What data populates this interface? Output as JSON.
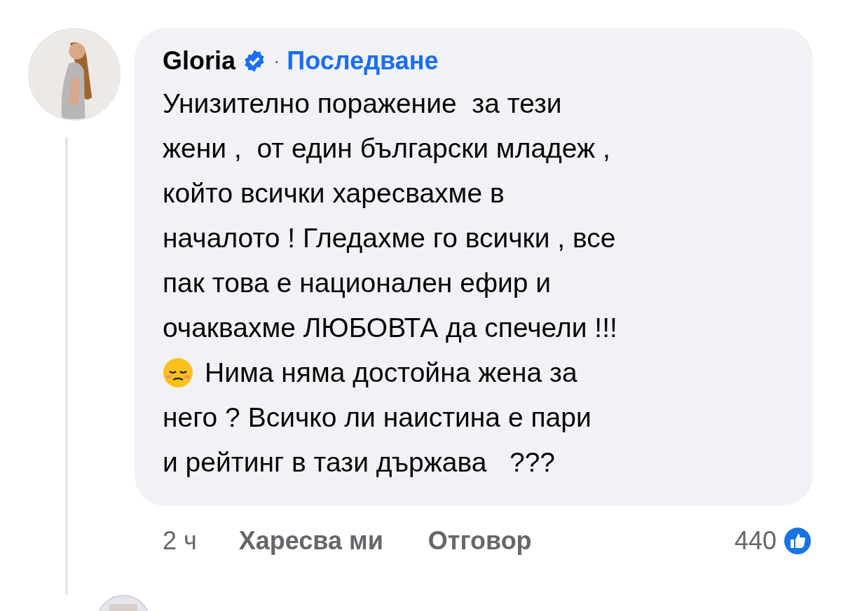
{
  "comment": {
    "author": "Gloria",
    "verified": true,
    "separator": "·",
    "follow": "Последване",
    "text_before": "Унизително поражение  за тези\nжени ,  от един български младеж ,\nкойто всички харесвахме в\nначалото ! Гледахме го всички , все\nпак това е национален ефир и\nочаквахме ЛЮБОВТА да спечели !!!",
    "text_emoji_line": "Нима няма достойна жена за",
    "text_after": "него ? Всичко ли наистина е пари\nи рейтинг в тази държава   ???"
  },
  "actions": {
    "time": "2 ч",
    "like": "Харесва ми",
    "reply": "Отговор",
    "reaction_count": "440"
  }
}
